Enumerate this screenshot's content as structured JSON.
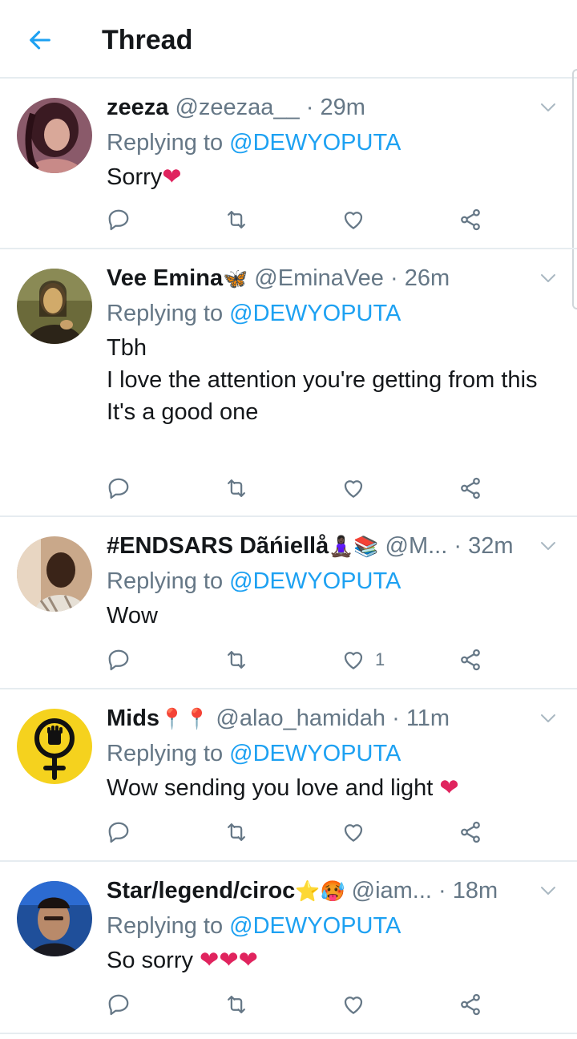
{
  "header": {
    "title": "Thread",
    "back_icon": "arrow-left-icon"
  },
  "colors": {
    "accent": "#1da1f2",
    "text": "#14171a",
    "secondary": "#657786",
    "divider": "#e6ecf0",
    "heart": "#e0245e"
  },
  "tweets": [
    {
      "name": "zeeza",
      "name_emoji": "",
      "handle": "@zeezaa__",
      "dot": "·",
      "time": "29m",
      "replying_prefix": "Replying to",
      "replying_to": "@DEWYOPUTA",
      "text": "Sorry",
      "text_emoji": "❤",
      "like_count": ""
    },
    {
      "name": "Vee Emina",
      "name_emoji": "🦋",
      "handle": "@EminaVee",
      "dot": "·",
      "time": "26m",
      "replying_prefix": "Replying to",
      "replying_to": "@DEWYOPUTA",
      "text": "Tbh\nI love the attention you're getting from this\nIt's a good one",
      "text_emoji": "",
      "like_count": ""
    },
    {
      "name": "#ENDSARS Dãńiellå",
      "name_emoji": "🧘🏿‍♀️📚",
      "handle": "@M...",
      "dot": "·",
      "time": "32m",
      "replying_prefix": "Replying to",
      "replying_to": "@DEWYOPUTA",
      "text": "Wow",
      "text_emoji": "",
      "like_count": "1"
    },
    {
      "name": "Mids",
      "name_emoji": "📍📍",
      "handle": "@alao_hamidah",
      "dot": "·",
      "time": "11m",
      "replying_prefix": "Replying to",
      "replying_to": "@DEWYOPUTA",
      "text": "Wow sending you love and light ",
      "text_emoji": "❤",
      "like_count": ""
    },
    {
      "name": "Star/legend/ciroc",
      "name_emoji": "⭐🥵",
      "handle": "@iam...",
      "dot": "·",
      "time": "18m",
      "replying_prefix": "Replying to",
      "replying_to": "@DEWYOPUTA",
      "text": "So sorry ",
      "text_emoji": "❤❤❤",
      "like_count": ""
    }
  ]
}
